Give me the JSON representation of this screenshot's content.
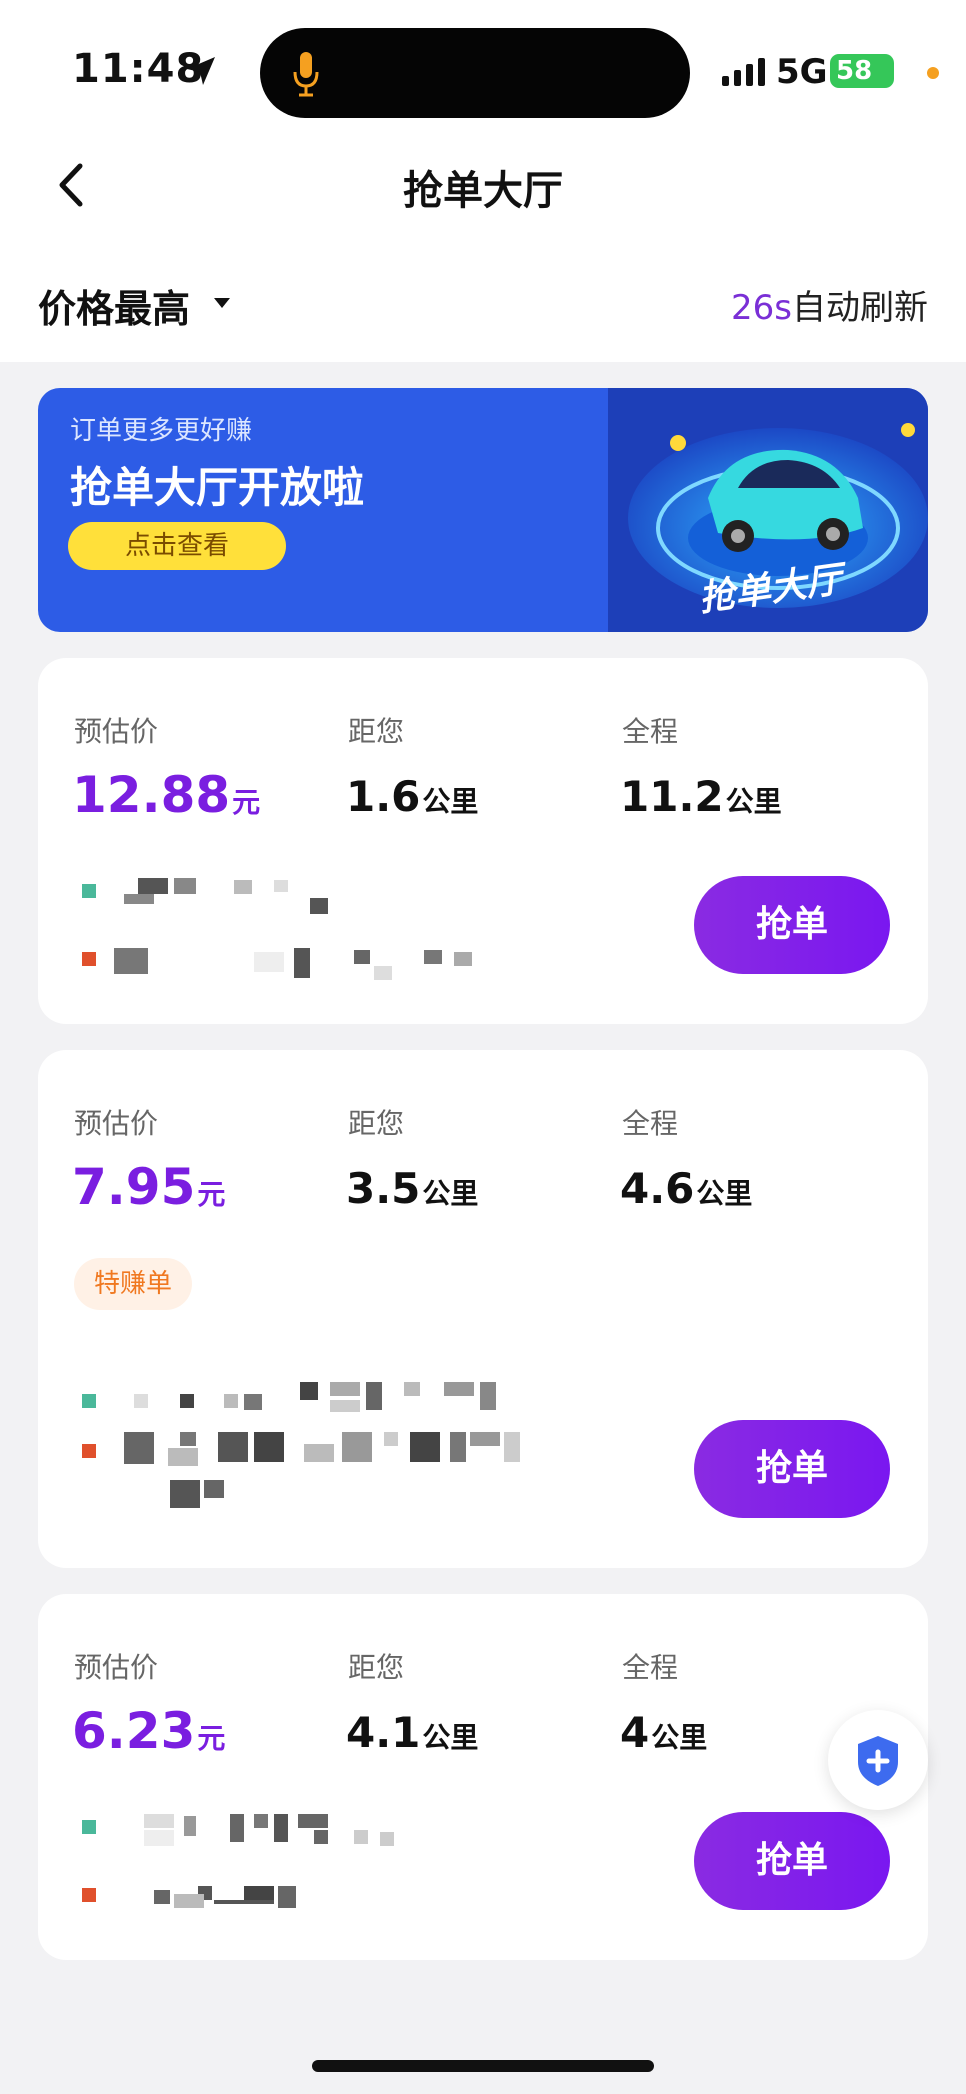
{
  "status_bar": {
    "time": "11:48",
    "network": "5G",
    "battery": "58"
  },
  "nav": {
    "title": "抢单大厅"
  },
  "filter": {
    "sort_label": "价格最高",
    "refresh_seconds": "26s",
    "refresh_label": "自动刷新"
  },
  "banner": {
    "subtitle": "订单更多更好赚",
    "headline": "抢单大厅开放啦",
    "button": "点击查看",
    "art_label": "抢单大厅"
  },
  "orders": [
    {
      "price_label": "预估价",
      "price": "12.88",
      "price_unit": "元",
      "distance_label": "距您",
      "distance": "1.6",
      "distance_unit": "公里",
      "total_label": "全程",
      "total": "11.2",
      "total_unit": "公里",
      "button": "抢单"
    },
    {
      "price_label": "预估价",
      "price": "7.95",
      "price_unit": "元",
      "distance_label": "距您",
      "distance": "3.5",
      "distance_unit": "公里",
      "total_label": "全程",
      "total": "4.6",
      "total_unit": "公里",
      "tag": "特赚单",
      "button": "抢单"
    },
    {
      "price_label": "预估价",
      "price": "6.23",
      "price_unit": "元",
      "distance_label": "距您",
      "distance": "4.1",
      "distance_unit": "公里",
      "total_label": "全程",
      "total": "4",
      "total_unit": "公里",
      "button": "抢单"
    }
  ],
  "colors": {
    "accent": "#7a1ee0",
    "banner": "#2d5ce6",
    "start_dot": "#4ab89a",
    "end_dot": "#e0502c"
  },
  "icons": [
    "back-arrow-icon",
    "location-arrow-icon",
    "mic-icon",
    "signal-icon",
    "battery-icon",
    "caret-down-icon",
    "shield-plus-icon"
  ]
}
